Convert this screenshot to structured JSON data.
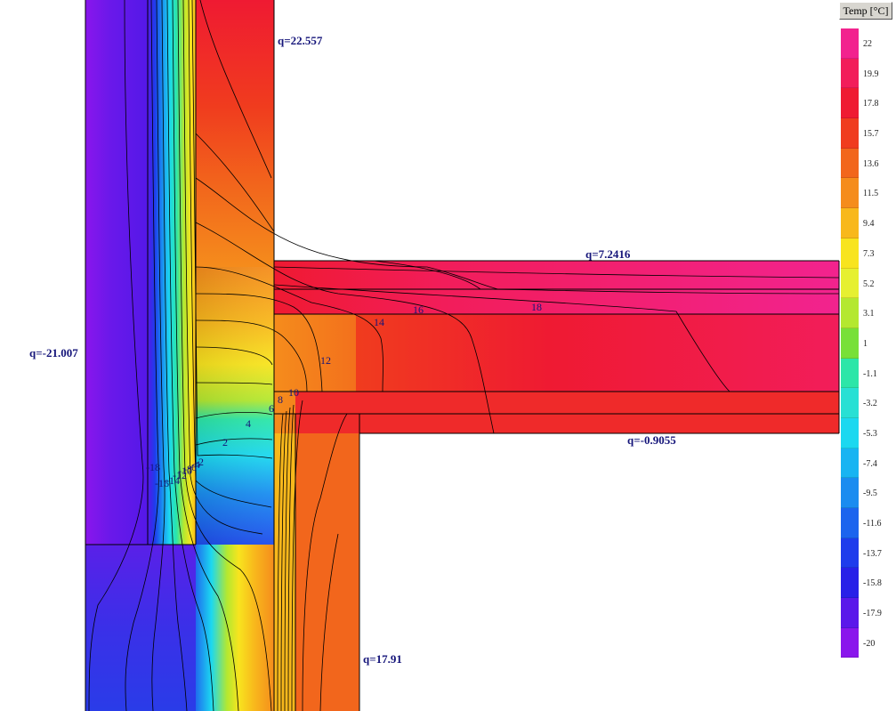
{
  "legend": {
    "title": "Temp [°C]",
    "entries": [
      {
        "label": "22",
        "color": "#f2238e"
      },
      {
        "label": "19.9",
        "color": "#f21d5a"
      },
      {
        "label": "17.8",
        "color": "#ef1a32"
      },
      {
        "label": "15.7",
        "color": "#f03c1e"
      },
      {
        "label": "13.6",
        "color": "#f2661c"
      },
      {
        "label": "11.5",
        "color": "#f58c1c"
      },
      {
        "label": "9.4",
        "color": "#f8b81c"
      },
      {
        "label": "7.3",
        "color": "#f8e41e"
      },
      {
        "label": "5.2",
        "color": "#e6f030"
      },
      {
        "label": "3.1",
        "color": "#b4e830"
      },
      {
        "label": "1",
        "color": "#78e038"
      },
      {
        "label": "-1.1",
        "color": "#2ce6a8"
      },
      {
        "label": "-3.2",
        "color": "#28e0d4"
      },
      {
        "label": "-5.3",
        "color": "#1cd8f0"
      },
      {
        "label": "-7.4",
        "color": "#18b4f2"
      },
      {
        "label": "-9.5",
        "color": "#1a8cf0"
      },
      {
        "label": "-11.6",
        "color": "#1c64ee"
      },
      {
        "label": "-13.7",
        "color": "#1e3cec"
      },
      {
        "label": "-15.8",
        "color": "#2820e8"
      },
      {
        "label": "-17.9",
        "color": "#5a18ea"
      },
      {
        "label": "-20",
        "color": "#8a16ec"
      }
    ]
  },
  "flux_labels": {
    "top": "q=22.557",
    "balcony_top": "q=7.2416",
    "left": "q=-21.007",
    "balcony_bottom": "q=-0.9055",
    "bottom": "q=17.91"
  },
  "isotherm_labels": [
    "2",
    "4",
    "6",
    "8",
    "10",
    "12",
    "14",
    "16",
    "18",
    "-18",
    "-16",
    "-14",
    "-12",
    "-10",
    "-8",
    "-6",
    "-4",
    "-2"
  ]
}
